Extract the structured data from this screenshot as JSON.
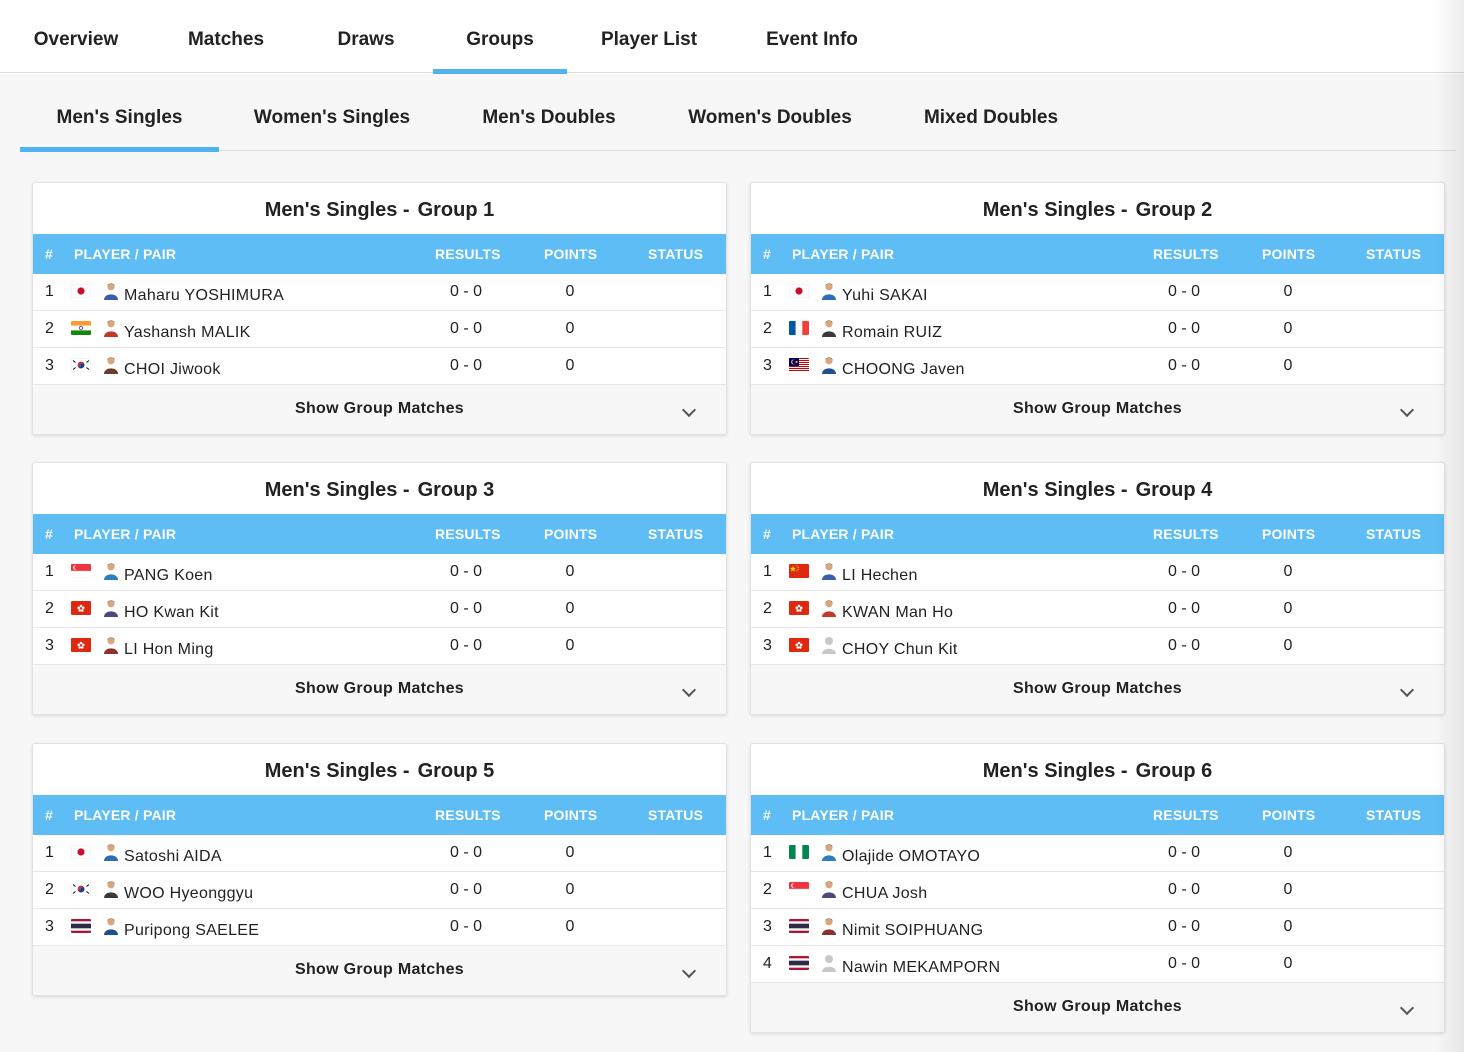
{
  "top_nav": {
    "tabs": [
      {
        "label": "Overview",
        "active": false
      },
      {
        "label": "Matches",
        "active": false
      },
      {
        "label": "Draws",
        "active": false
      },
      {
        "label": "Groups",
        "active": true
      },
      {
        "label": "Player List",
        "active": false
      },
      {
        "label": "Event Info",
        "active": false
      }
    ]
  },
  "sub_nav": {
    "tabs": [
      {
        "label": "Men's Singles",
        "active": true
      },
      {
        "label": "Women's Singles",
        "active": false
      },
      {
        "label": "Men's Doubles",
        "active": false
      },
      {
        "label": "Women's Doubles",
        "active": false
      },
      {
        "label": "Mixed Doubles",
        "active": false
      }
    ]
  },
  "table_headers": {
    "num": "#",
    "player": "PLAYER / PAIR",
    "results": "RESULTS",
    "points": "POINTS",
    "status": "STATUS"
  },
  "show_matches_label": "Show Group Matches",
  "colors": {
    "accent": "#5ebdf5",
    "tab_underline": "#4fb3f0"
  },
  "groups": [
    {
      "event": "Men's Singles -",
      "name": "Group 1",
      "rows": [
        {
          "num": "1",
          "flag": "japan-flag",
          "avatar": "player-photo",
          "player": "Maharu YOSHIMURA",
          "results": "0 - 0",
          "points": "0",
          "status": ""
        },
        {
          "num": "2",
          "flag": "india-flag",
          "avatar": "player-photo",
          "player": "Yashansh MALIK",
          "results": "0 - 0",
          "points": "0",
          "status": ""
        },
        {
          "num": "3",
          "flag": "korea-flag",
          "avatar": "player-photo",
          "player": "CHOI Jiwook",
          "results": "0 - 0",
          "points": "0",
          "status": ""
        }
      ]
    },
    {
      "event": "Men's Singles -",
      "name": "Group 2",
      "rows": [
        {
          "num": "1",
          "flag": "japan-flag",
          "avatar": "player-photo",
          "player": "Yuhi SAKAI",
          "results": "0 - 0",
          "points": "0",
          "status": ""
        },
        {
          "num": "2",
          "flag": "france-flag",
          "avatar": "player-photo",
          "player": "Romain RUIZ",
          "results": "0 - 0",
          "points": "0",
          "status": ""
        },
        {
          "num": "3",
          "flag": "malaysia-flag",
          "avatar": "player-photo",
          "player": "CHOONG Javen",
          "results": "0 - 0",
          "points": "0",
          "status": ""
        }
      ]
    },
    {
      "event": "Men's Singles -",
      "name": "Group 3",
      "rows": [
        {
          "num": "1",
          "flag": "singapore-flag",
          "avatar": "player-photo",
          "player": "PANG Koen",
          "results": "0 - 0",
          "points": "0",
          "status": ""
        },
        {
          "num": "2",
          "flag": "hong-kong-flag",
          "avatar": "player-photo",
          "player": "HO Kwan Kit",
          "results": "0 - 0",
          "points": "0",
          "status": ""
        },
        {
          "num": "3",
          "flag": "hong-kong-flag",
          "avatar": "player-photo",
          "player": "LI Hon Ming",
          "results": "0 - 0",
          "points": "0",
          "status": ""
        }
      ]
    },
    {
      "event": "Men's Singles -",
      "name": "Group 4",
      "rows": [
        {
          "num": "1",
          "flag": "china-flag",
          "avatar": "player-photo",
          "player": "LI Hechen",
          "results": "0 - 0",
          "points": "0",
          "status": ""
        },
        {
          "num": "2",
          "flag": "hong-kong-flag",
          "avatar": "player-photo",
          "player": "KWAN Man Ho",
          "results": "0 - 0",
          "points": "0",
          "status": ""
        },
        {
          "num": "3",
          "flag": "hong-kong-flag",
          "avatar": "placeholder-avatar",
          "player": "CHOY Chun Kit",
          "results": "0 - 0",
          "points": "0",
          "status": ""
        }
      ]
    },
    {
      "event": "Men's Singles -",
      "name": "Group 5",
      "rows": [
        {
          "num": "1",
          "flag": "japan-flag",
          "avatar": "player-photo",
          "player": "Satoshi AIDA",
          "results": "0 - 0",
          "points": "0",
          "status": ""
        },
        {
          "num": "2",
          "flag": "korea-flag",
          "avatar": "player-photo",
          "player": "WOO Hyeonggyu",
          "results": "0 - 0",
          "points": "0",
          "status": ""
        },
        {
          "num": "3",
          "flag": "thailand-flag",
          "avatar": "player-photo",
          "player": "Puripong SAELEE",
          "results": "0 - 0",
          "points": "0",
          "status": ""
        }
      ]
    },
    {
      "event": "Men's Singles -",
      "name": "Group 6",
      "rows": [
        {
          "num": "1",
          "flag": "nigeria-flag",
          "avatar": "player-photo",
          "player": "Olajide OMOTAYO",
          "results": "0 - 0",
          "points": "0",
          "status": ""
        },
        {
          "num": "2",
          "flag": "singapore-flag",
          "avatar": "player-photo",
          "player": "CHUA Josh",
          "results": "0 - 0",
          "points": "0",
          "status": ""
        },
        {
          "num": "3",
          "flag": "thailand-flag",
          "avatar": "player-photo",
          "player": "Nimit SOIPHUANG",
          "results": "0 - 0",
          "points": "0",
          "status": ""
        },
        {
          "num": "4",
          "flag": "thailand-flag",
          "avatar": "placeholder-avatar",
          "player": "Nawin MEKAMPORN",
          "results": "0 - 0",
          "points": "0",
          "status": ""
        }
      ]
    }
  ]
}
